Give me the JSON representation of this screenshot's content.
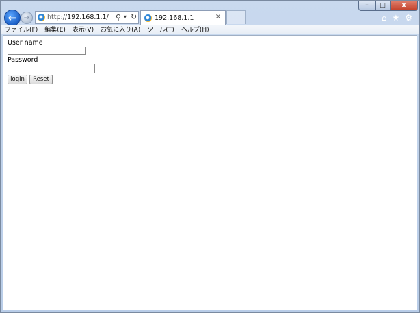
{
  "browser": {
    "address": {
      "prefix": "http://",
      "host": "192.168.1.1/"
    },
    "tab": {
      "title": "192.168.1.1",
      "close_glyph": "×"
    },
    "icons": [
      "back-arrow-icon",
      "forward-arrow-icon",
      "ie-logo-icon",
      "search-icon",
      "dropdown-icon",
      "refresh-icon",
      "home-icon",
      "favorites-star-icon",
      "settings-gear-icon"
    ],
    "window_controls": {
      "minimize": "–",
      "maximize": "□",
      "close": "x"
    }
  },
  "menu": {
    "items": [
      "ファイル(F)",
      "編集(E)",
      "表示(V)",
      "お気に入り(A)",
      "ツール(T)",
      "ヘルプ(H)"
    ]
  },
  "form": {
    "username_label": "User name",
    "username_value": "",
    "password_label": "Password",
    "password_value": "",
    "login_label": "login",
    "reset_label": "Reset"
  },
  "colors": {
    "frame": "#b9cde8",
    "back_button": "#1c5fc6",
    "close_button": "#c2402a"
  }
}
